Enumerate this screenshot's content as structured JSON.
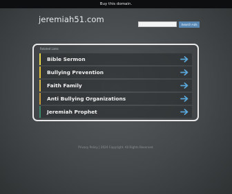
{
  "topbar": {
    "buy_text": "Buy this domain."
  },
  "header": {
    "domain": "jeremiah51.com"
  },
  "search": {
    "placeholder": "",
    "button_label": "Search Ads"
  },
  "related": {
    "heading": "Related Links",
    "items": [
      {
        "label": "Bible Sermon",
        "accent": "#e7d84a"
      },
      {
        "label": "Bullying Prevention",
        "accent": "#e7c33a"
      },
      {
        "label": "Faith Family",
        "accent": "#d9b94a"
      },
      {
        "label": "Anti Bullying Organizations",
        "accent": "#c79a3a"
      },
      {
        "label": "Jeremiah Prophet",
        "accent": "#3f8a6a"
      }
    ],
    "arrow_icon": "arrow-right-icon",
    "arrow_color": "#5aa7d9"
  },
  "footer": {
    "text": "Privacy Policy | 2024 Copyright. All Rights Reserved."
  }
}
